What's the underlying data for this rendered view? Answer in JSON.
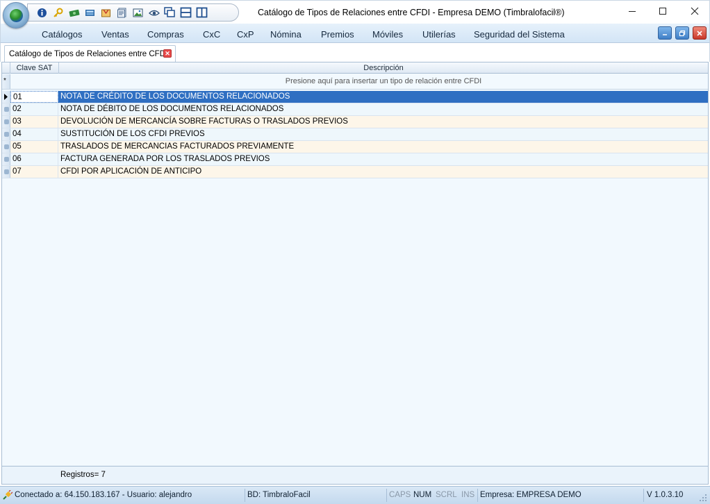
{
  "window": {
    "title": "Catálogo de Tipos de Relaciones entre CFDI - Empresa DEMO (Timbralofacil®)"
  },
  "quick_access": [
    {
      "name": "info-icon",
      "color": "#1d4f9c"
    },
    {
      "name": "key-icon",
      "color": "#d9a400"
    },
    {
      "name": "money-icon",
      "color": "#2e8b3a"
    },
    {
      "name": "calculator-icon",
      "color": "#2d6aa8"
    },
    {
      "name": "inbox-icon",
      "color": "#c9871c"
    },
    {
      "name": "documents-icon",
      "color": "#4b6b91"
    },
    {
      "name": "image-icon",
      "color": "#3b8b3b"
    },
    {
      "name": "eye-icon",
      "color": "#2c4f7a"
    },
    {
      "name": "cascade-windows-icon",
      "color": "#1f4f8f"
    },
    {
      "name": "tile-horizontal-icon",
      "color": "#1f4f8f"
    },
    {
      "name": "tile-vertical-icon",
      "color": "#1f4f8f"
    }
  ],
  "menu": [
    "Catálogos",
    "Ventas",
    "Compras",
    "CxC",
    "CxP",
    "Nómina",
    "Premios",
    "Móviles",
    "Utilerías",
    "Seguridad del Sistema"
  ],
  "tab": {
    "label": "Catálogo de Tipos de Relaciones entre CFDI"
  },
  "grid": {
    "columns": [
      "Clave SAT",
      "Descripción"
    ],
    "new_row_hint": "Presione aquí para insertar un tipo de relación entre CFDI",
    "rows": [
      {
        "clave": "01",
        "descripcion": "NOTA DE CRÉDITO DE LOS DOCUMENTOS RELACIONADOS"
      },
      {
        "clave": "02",
        "descripcion": "NOTA DE DÉBITO DE LOS DOCUMENTOS RELACIONADOS"
      },
      {
        "clave": "03",
        "descripcion": "DEVOLUCIÓN DE MERCANCÍA SOBRE FACTURAS O TRASLADOS PREVIOS"
      },
      {
        "clave": "04",
        "descripcion": "SUSTITUCIÓN DE LOS CFDI PREVIOS"
      },
      {
        "clave": "05",
        "descripcion": "TRASLADOS DE MERCANCIAS FACTURADOS PREVIAMENTE"
      },
      {
        "clave": "06",
        "descripcion": "FACTURA GENERADA POR LOS TRASLADOS PREVIOS"
      },
      {
        "clave": "07",
        "descripcion": "CFDI POR APLICACIÓN DE ANTICIPO"
      }
    ],
    "footer": "Registros= 7"
  },
  "status": {
    "connection": "Conectado a: 64.150.183.167 - Usuario: alejandro",
    "database": "BD: TimbraloFacil",
    "caps": "CAPS",
    "num": "NUM",
    "scrl": "SCRL",
    "ins": "INS",
    "company": "Empresa: EMPRESA DEMO",
    "version": "V 1.0.3.10"
  },
  "colors": {
    "selection": "#2f6fc2",
    "row_alt": "#fdf6e9",
    "row_base": "#eef7fc"
  }
}
